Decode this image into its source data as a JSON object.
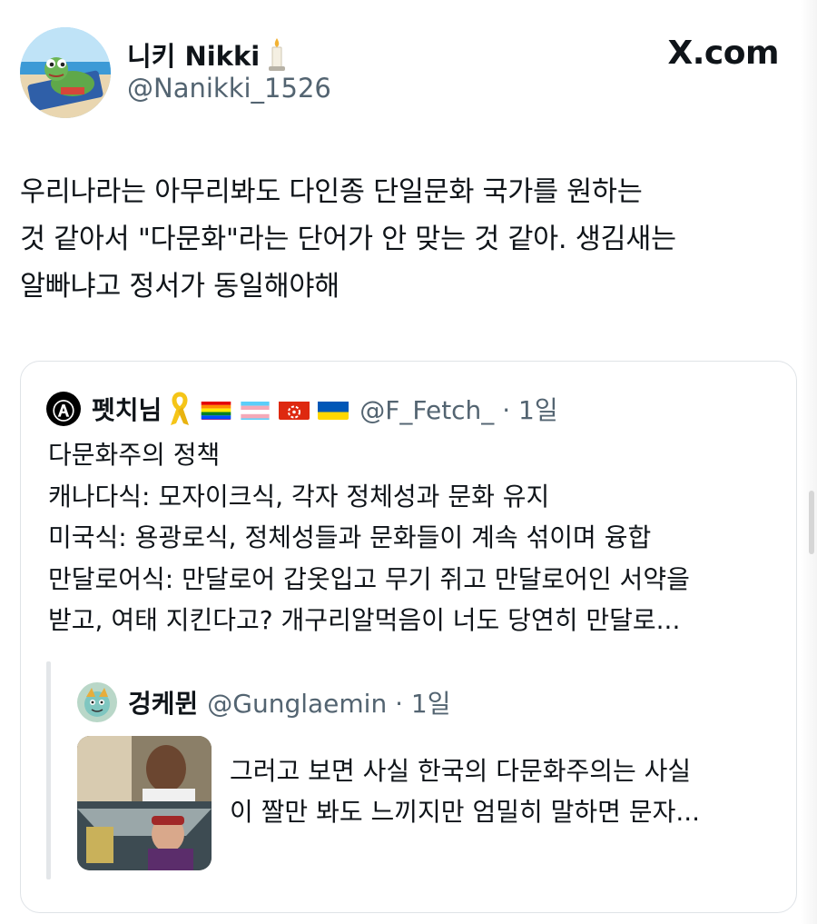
{
  "tweet": {
    "display_name": "니키 Nikki",
    "handle": "@Nanikki_1526",
    "text": "우리나라는 아무리봐도 다인종 단일문화 국가를 원하는\n것 같아서 \"다문화\"라는 단어가 안 맞는 것 같아. 생김새는\n알빠냐고 정서가 동일해야해",
    "avatar_icon": "frog-on-beach-chair-avatar",
    "name_emoji_icon": "candle-icon"
  },
  "brand": {
    "logo": "X.com"
  },
  "quoted": {
    "display_name": "펫치님",
    "handle_meta": "@F_Fetch_ · 1일",
    "text": "다문화주의 정책\n캐나다식: 모자이크식, 각자 정체성과 문화 유지\n미국식: 용광로식, 정체성들과 문화들이 계속 섞이며 융합\n만달로어식: 만달로어 갑옷입고 무기 쥐고 만달로어인 서약을\n받고, 여태 지킨다고? 개구리알먹음이 너도 당연히 만달로...",
    "avatar_icon": "anarchy-symbol-avatar",
    "badge_icons": [
      "yellow-ribbon-icon",
      "rainbow-flag-icon",
      "transgender-flag-icon",
      "hong-kong-flag-icon",
      "ukraine-flag-icon"
    ]
  },
  "nested": {
    "display_name": "겅케뮌",
    "handle_meta": "@Gunglaemin · 1일",
    "text": "그러고 보면 사실 한국의 다문화주의는 사실\n이 짤만 봐도 느끼지만 엄밀히 말하면 문자...",
    "avatar_icon": "cartoon-character-avatar",
    "thumbnail_icon": "market-video-thumbnail"
  },
  "colors": {
    "text": "#0f1419",
    "secondary": "#536471",
    "border": "#dfe3e7",
    "background": "#ffffff"
  }
}
